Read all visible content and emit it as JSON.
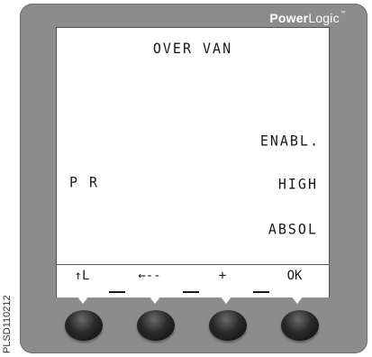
{
  "brand": {
    "bold": "Power",
    "rest": "Logic",
    "mark": "™"
  },
  "screen": {
    "title": "OVER VAN",
    "left_label": "P R",
    "values": [
      "ENABL.",
      "HIGH",
      "ABSOL"
    ]
  },
  "softkeys": [
    {
      "label": "↑L",
      "icon": "up-level-icon"
    },
    {
      "label": "←--",
      "icon": "left-arrow-icon"
    },
    {
      "label": "+",
      "icon": "plus-icon"
    },
    {
      "label": "OK",
      "icon": "ok-icon"
    }
  ],
  "side_id": "PLSD110212",
  "colors": {
    "bezel": "#8c8c8c",
    "lcd_bg": "#ffffff",
    "lcd_text": "#1a1a1a",
    "button": "#1a1a1a"
  }
}
